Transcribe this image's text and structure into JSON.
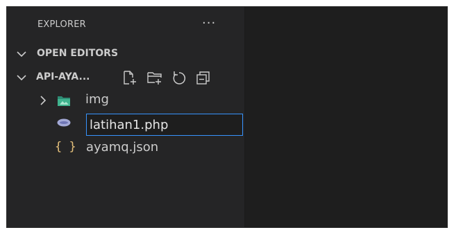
{
  "explorer": {
    "title": "EXPLORER",
    "more_actions_label": "···"
  },
  "open_editors": {
    "label": "OPEN EDITORS",
    "expanded": true
  },
  "folder": {
    "label": "API-AYA...",
    "expanded": true,
    "actions": [
      "new-file-icon",
      "new-folder-icon",
      "refresh-icon",
      "collapse-all-icon"
    ]
  },
  "tree": {
    "items": [
      {
        "label": "img",
        "type": "folder",
        "icon": "image-folder-icon",
        "expanded": false
      },
      {
        "label": "latihan1.php",
        "type": "file",
        "icon": "php-file-icon",
        "renaming": true
      },
      {
        "label": "ayamq.json",
        "type": "file",
        "icon": "json-file-icon",
        "icon_glyph": "{ }"
      }
    ]
  },
  "colors": {
    "sidebar_bg": "#252526",
    "editor_bg": "#1e1e1e",
    "text": "#cccccc",
    "focus_border": "#3794ff",
    "folder_icon": "#3fb38e",
    "json_icon": "#e5c07b",
    "php_icon": "#a3a9d6"
  }
}
